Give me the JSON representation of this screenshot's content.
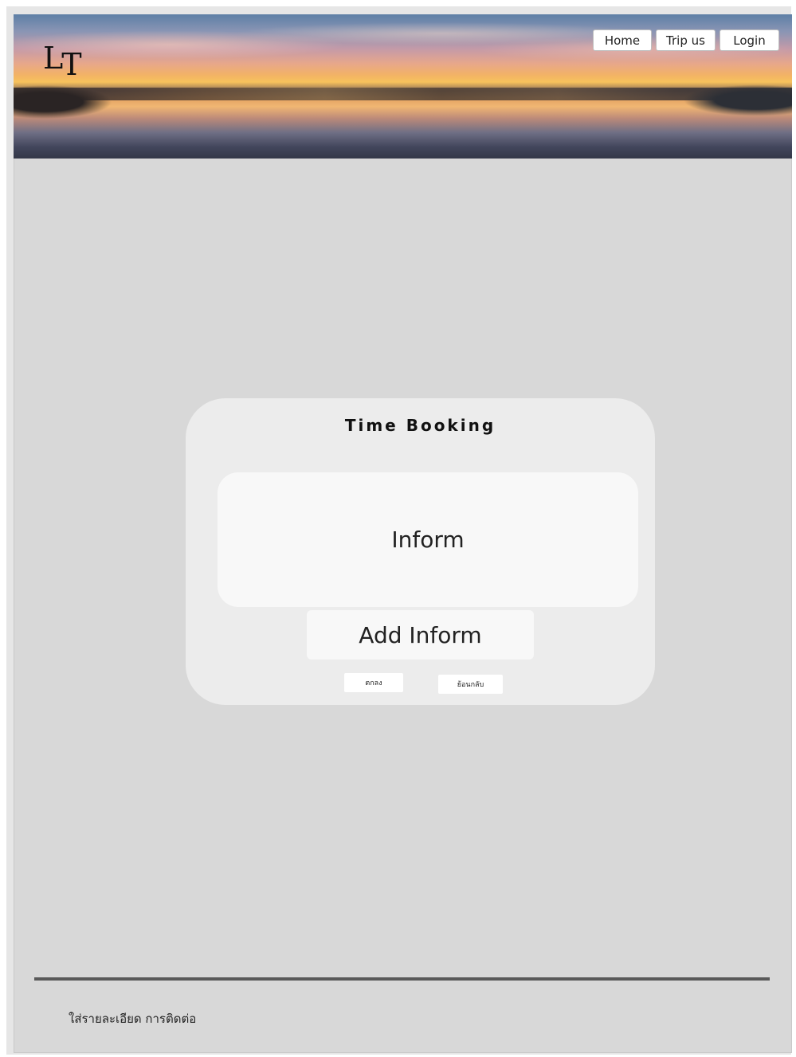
{
  "header": {
    "logo": {
      "l": "L",
      "t": "T"
    },
    "nav": [
      {
        "label": "Home"
      },
      {
        "label": "Trip us"
      },
      {
        "label": "Login"
      }
    ]
  },
  "booking": {
    "title": "Time Booking",
    "inform_label": "Inform",
    "add_inform_label": "Add Inform",
    "ok_label": "ตกลง",
    "back_label": "ย้อนกลับ"
  },
  "footer": {
    "contact_text": "ใส่รายละเอียด การติดต่อ"
  }
}
